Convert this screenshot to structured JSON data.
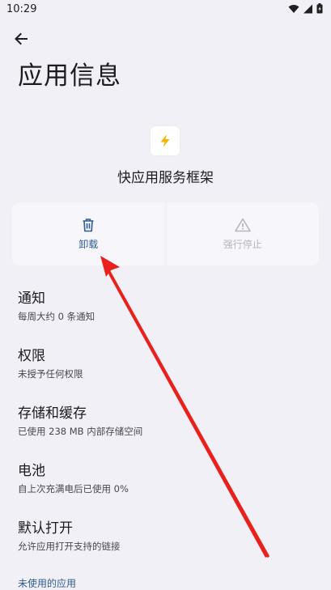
{
  "status_bar": {
    "time": "10:29"
  },
  "page": {
    "title": "应用信息"
  },
  "app": {
    "name": "快应用服务框架"
  },
  "actions": {
    "uninstall_label": "卸载",
    "force_stop_label": "强行停止"
  },
  "settings": [
    {
      "title": "通知",
      "subtitle": "每周大约 0 条通知"
    },
    {
      "title": "权限",
      "subtitle": "未授予任何权限"
    },
    {
      "title": "存储和缓存",
      "subtitle": "已使用 238 MB 内部存储空间"
    },
    {
      "title": "电池",
      "subtitle": "自上次充满电后已使用 0%"
    },
    {
      "title": "默认打开",
      "subtitle": "允许应用打开支持的链接"
    }
  ],
  "section": {
    "unused_apps": "未使用的应用"
  },
  "colors": {
    "background": "#f1f0f6",
    "accent": "#2f5d91",
    "annotation_arrow": "#e8211c",
    "app_icon": "#f5b400"
  },
  "icons": {
    "back": "arrow-left-icon",
    "app": "lightning-icon",
    "uninstall": "trash-icon",
    "force_stop": "warning-icon"
  }
}
